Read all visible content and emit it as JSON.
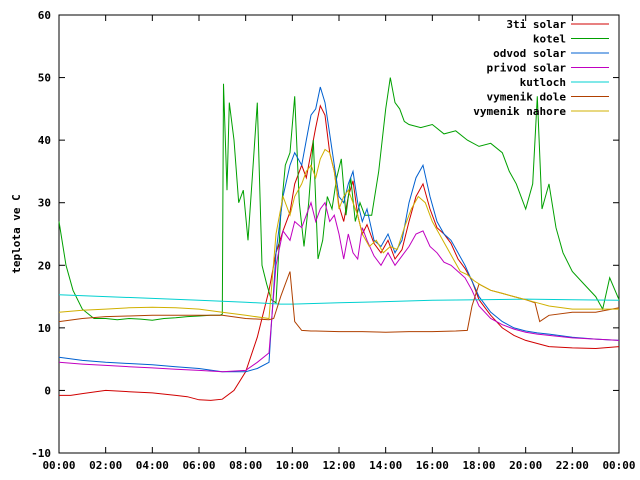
{
  "chart_data": {
    "type": "line",
    "title": "",
    "xlabel": "",
    "ylabel": "teplota ve C",
    "xlim": [
      0,
      24
    ],
    "ylim": [
      -10,
      60
    ],
    "x_ticks": [
      0,
      2,
      4,
      6,
      8,
      10,
      12,
      14,
      16,
      18,
      20,
      22,
      24
    ],
    "x_tick_labels": [
      "00:00",
      "02:00",
      "04:00",
      "06:00",
      "08:00",
      "10:00",
      "12:00",
      "14:00",
      "16:00",
      "18:00",
      "20:00",
      "22:00",
      "00:00"
    ],
    "y_ticks": [
      -10,
      0,
      10,
      20,
      30,
      40,
      50,
      60
    ],
    "grid": false,
    "legend_position": "top-right",
    "series": [
      {
        "name": "3ti solar",
        "color": "#d00000",
        "x": [
          0,
          0.5,
          1,
          2,
          3,
          4,
          5,
          5.5,
          6,
          6.5,
          7,
          7.5,
          8,
          8.5,
          9,
          9.3,
          9.6,
          9.9,
          10.1,
          10.4,
          10.6,
          10.8,
          11.0,
          11.2,
          11.4,
          11.6,
          11.8,
          12.0,
          12.2,
          12.4,
          12.6,
          12.8,
          13.0,
          13.2,
          13.5,
          13.8,
          14.1,
          14.4,
          14.7,
          15.0,
          15.3,
          15.6,
          15.9,
          16.2,
          16.5,
          16.8,
          17.1,
          17.4,
          17.7,
          18.0,
          18.5,
          19,
          19.5,
          20,
          20.5,
          21,
          22,
          23,
          24
        ],
        "values": [
          -0.8,
          -0.8,
          -0.5,
          0,
          -0.2,
          -0.4,
          -0.8,
          -1.0,
          -1.5,
          -1.6,
          -1.4,
          0,
          3.0,
          8.5,
          16.0,
          22.0,
          25.5,
          28.5,
          33.0,
          36.0,
          34.0,
          38.0,
          42.0,
          45.5,
          44.0,
          38.0,
          35.0,
          29.5,
          27.0,
          31.0,
          33.5,
          28.0,
          25.0,
          26.5,
          23.5,
          22.0,
          24.0,
          21.0,
          22.5,
          27.0,
          31.0,
          33.0,
          29.0,
          26.0,
          25.0,
          23.5,
          21.0,
          19.5,
          17.5,
          14.5,
          12.0,
          10.0,
          8.8,
          8.0,
          7.5,
          7.0,
          6.8,
          6.7,
          7.0
        ]
      },
      {
        "name": "kotel",
        "color": "#00a000",
        "x": [
          0,
          0.3,
          0.6,
          1,
          1.5,
          2,
          2.5,
          3,
          3.5,
          4,
          4.5,
          5,
          5.5,
          6,
          6.5,
          6.9,
          7.0,
          7.05,
          7.2,
          7.3,
          7.5,
          7.7,
          7.9,
          8.1,
          8.3,
          8.5,
          8.7,
          8.9,
          9.1,
          9.3,
          9.5,
          9.7,
          9.9,
          10.1,
          10.3,
          10.5,
          10.7,
          10.9,
          11.1,
          11.3,
          11.5,
          11.7,
          11.9,
          12.1,
          12.3,
          12.5,
          12.7,
          12.9,
          13.1,
          13.4,
          13.7,
          14.0,
          14.2,
          14.4,
          14.6,
          14.8,
          15.0,
          15.5,
          16.0,
          16.5,
          17.0,
          17.5,
          18.0,
          18.5,
          19.0,
          19.3,
          19.6,
          20.0,
          20.3,
          20.5,
          20.7,
          21.0,
          21.3,
          21.6,
          22.0,
          22.5,
          23.0,
          23.3,
          23.6,
          24
        ],
        "values": [
          27,
          20,
          16,
          13,
          11.5,
          11.5,
          11.3,
          11.5,
          11.4,
          11.2,
          11.5,
          11.6,
          11.8,
          11.9,
          12.0,
          12.0,
          12.2,
          49.0,
          32.0,
          46.0,
          40.0,
          30.0,
          32.0,
          24.0,
          35.0,
          46.0,
          20.0,
          17.0,
          14.5,
          14.0,
          28.0,
          36.0,
          38.0,
          47.0,
          30.0,
          23.0,
          30.0,
          40.0,
          21.0,
          24.0,
          31.0,
          29.0,
          34.0,
          37.0,
          28.0,
          34.0,
          27.0,
          30.0,
          28.0,
          28.0,
          35.0,
          45.0,
          50.0,
          46.0,
          45.0,
          43.0,
          42.5,
          42.0,
          42.5,
          41.0,
          41.5,
          40.0,
          39.0,
          39.5,
          38.0,
          35.0,
          33.0,
          29.0,
          33.0,
          47.0,
          29.0,
          33.0,
          26.0,
          22.0,
          19.0,
          17.0,
          15.0,
          13.0,
          18.0,
          14.5
        ]
      },
      {
        "name": "odvod solar",
        "color": "#0060d0",
        "x": [
          0,
          1,
          2,
          3,
          4,
          5,
          6,
          7,
          8,
          8.5,
          9,
          9.3,
          9.6,
          9.9,
          10.1,
          10.4,
          10.6,
          10.8,
          11.0,
          11.2,
          11.4,
          11.6,
          11.8,
          12.0,
          12.2,
          12.4,
          12.6,
          12.8,
          13.0,
          13.2,
          13.5,
          13.8,
          14.1,
          14.4,
          14.7,
          15.0,
          15.3,
          15.6,
          15.9,
          16.2,
          16.5,
          16.8,
          17.1,
          17.4,
          17.7,
          18.0,
          18.5,
          19,
          19.5,
          20,
          20.5,
          21,
          22,
          23,
          24
        ],
        "values": [
          5.3,
          4.8,
          4.5,
          4.3,
          4.1,
          3.8,
          3.5,
          3.0,
          3.0,
          3.5,
          4.5,
          22.0,
          31.0,
          36.0,
          38.0,
          36.0,
          40.0,
          44.0,
          45.0,
          48.5,
          46.0,
          41.0,
          36.0,
          31.0,
          30.0,
          33.0,
          35.0,
          30.0,
          27.0,
          29.0,
          24.0,
          23.0,
          25.0,
          22.0,
          24.0,
          30.0,
          34.0,
          36.0,
          31.0,
          27.0,
          25.0,
          24.0,
          22.0,
          20.0,
          17.5,
          15.0,
          12.5,
          11.0,
          10.0,
          9.5,
          9.2,
          9.0,
          8.5,
          8.2,
          8.0
        ]
      },
      {
        "name": "privod solar",
        "color": "#c000c0",
        "x": [
          0,
          1,
          2,
          3,
          4,
          5,
          6,
          7,
          8,
          8.5,
          9,
          9.3,
          9.6,
          9.9,
          10.1,
          10.4,
          10.6,
          10.8,
          11.0,
          11.2,
          11.4,
          11.6,
          11.8,
          12.0,
          12.2,
          12.4,
          12.6,
          12.8,
          13.0,
          13.2,
          13.5,
          13.8,
          14.1,
          14.4,
          14.7,
          15.0,
          15.3,
          15.6,
          15.9,
          16.2,
          16.5,
          16.8,
          17.1,
          17.4,
          17.7,
          18.0,
          18.5,
          19,
          19.5,
          20,
          20.5,
          21,
          22,
          23,
          24
        ],
        "values": [
          4.5,
          4.2,
          4.0,
          3.8,
          3.6,
          3.4,
          3.2,
          3.0,
          3.2,
          4.5,
          6.0,
          20.0,
          25.5,
          24.0,
          27.0,
          26.0,
          28.0,
          30.0,
          27.0,
          29.0,
          30.0,
          27.0,
          28.0,
          25.0,
          21.0,
          25.0,
          22.0,
          21.0,
          26.0,
          24.0,
          21.5,
          20.0,
          22.0,
          20.0,
          21.5,
          23.0,
          25.0,
          25.5,
          23.0,
          22.0,
          20.5,
          20.0,
          19.0,
          18.0,
          16.0,
          13.5,
          11.5,
          10.5,
          9.8,
          9.3,
          9.0,
          8.8,
          8.4,
          8.2,
          8.0
        ]
      },
      {
        "name": "kutloch",
        "color": "#00d0d0",
        "x": [
          0,
          2,
          4,
          6,
          8,
          9.5,
          10,
          12,
          14,
          16,
          18,
          20,
          22,
          24
        ],
        "values": [
          15.3,
          15.0,
          14.7,
          14.4,
          14.1,
          13.8,
          13.8,
          14.0,
          14.2,
          14.4,
          14.5,
          14.6,
          14.5,
          14.4
        ]
      },
      {
        "name": "vymenik dole",
        "color": "#b04000",
        "x": [
          0,
          1,
          2,
          3,
          4,
          5,
          6,
          7,
          8,
          9,
          9.2,
          9.5,
          9.7,
          9.9,
          10.1,
          10.4,
          10.8,
          11,
          12,
          13,
          14,
          15,
          16,
          17,
          17.5,
          17.7,
          18.0,
          18.5,
          19,
          19.5,
          20,
          20.4,
          20.6,
          21,
          22,
          23,
          24
        ],
        "values": [
          11.0,
          11.5,
          11.8,
          11.9,
          12.0,
          12.0,
          12.0,
          12.0,
          11.5,
          11.3,
          11.5,
          15.0,
          17.0,
          19.0,
          11.0,
          9.6,
          9.5,
          9.5,
          9.4,
          9.4,
          9.3,
          9.4,
          9.4,
          9.5,
          9.6,
          13.5,
          17.0,
          16.0,
          15.5,
          15.0,
          14.5,
          14.0,
          11.0,
          12.0,
          12.5,
          12.5,
          13.2
        ]
      },
      {
        "name": "vymenik nahore",
        "color": "#d0b000",
        "x": [
          0,
          1,
          2,
          3,
          4,
          5,
          6,
          7,
          8,
          9,
          9.3,
          9.6,
          9.9,
          10.1,
          10.4,
          10.6,
          10.8,
          11.0,
          11.2,
          11.4,
          11.6,
          11.8,
          12.0,
          12.2,
          12.4,
          12.6,
          12.8,
          13.0,
          13.3,
          13.6,
          13.9,
          14.2,
          14.5,
          14.8,
          15.1,
          15.4,
          15.7,
          16.0,
          16.3,
          16.6,
          16.9,
          17.2,
          17.5,
          17.8,
          18.1,
          18.5,
          19,
          19.5,
          20,
          20.5,
          21,
          22,
          23,
          24
        ],
        "values": [
          12.5,
          12.8,
          13.0,
          13.2,
          13.3,
          13.2,
          13.0,
          12.5,
          12.0,
          11.5,
          25.0,
          31.0,
          28.0,
          31.0,
          33.0,
          35.0,
          36.0,
          34.0,
          37.0,
          38.5,
          38.0,
          35.0,
          29.0,
          31.0,
          32.0,
          30.0,
          28.0,
          25.0,
          23.0,
          24.0,
          22.0,
          23.0,
          22.5,
          26.0,
          29.0,
          31.0,
          30.0,
          27.0,
          25.0,
          23.0,
          21.0,
          19.0,
          18.5,
          17.5,
          16.8,
          16.0,
          15.5,
          15.0,
          14.5,
          14.0,
          13.5,
          13.0,
          13.0,
          13.0
        ]
      }
    ]
  }
}
